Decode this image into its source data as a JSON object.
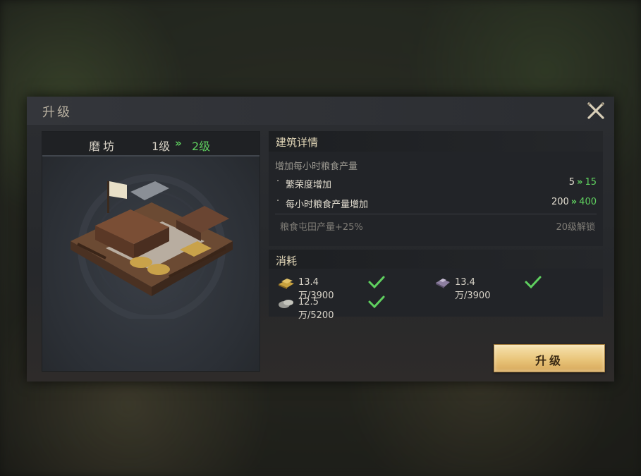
{
  "dialog": {
    "title": "升级",
    "close_icon": "close-x-icon"
  },
  "building": {
    "name": "磨坊",
    "level_current": "1级",
    "level_arrow": "»",
    "level_next": "2级"
  },
  "details": {
    "header": "建筑详情",
    "description": "增加每小时粮食产量",
    "rows": [
      {
        "bullet": "·",
        "label": "繁荣度增加",
        "from": "5",
        "to": "15"
      },
      {
        "bullet": "·",
        "label": "每小时粮食产量增加",
        "from": "200",
        "to": "400"
      }
    ],
    "locked": {
      "label": "粮食屯田产量+25%",
      "requirement": "20级解锁"
    }
  },
  "costs": {
    "header": "消耗",
    "items": [
      {
        "icon": "gold-bars-icon",
        "text": "13.4万/3900",
        "met": true
      },
      {
        "icon": "iron-ore-icon",
        "text": "13.4万/3900",
        "met": true
      },
      {
        "icon": "stone-icon",
        "text": "12.5万/5200",
        "met": true
      }
    ]
  },
  "upgrade_button": {
    "label": "升级"
  },
  "colors": {
    "accent_green": "#5fd05f",
    "button_gold": "#e9c57a",
    "header_text": "#e2d7b8"
  }
}
